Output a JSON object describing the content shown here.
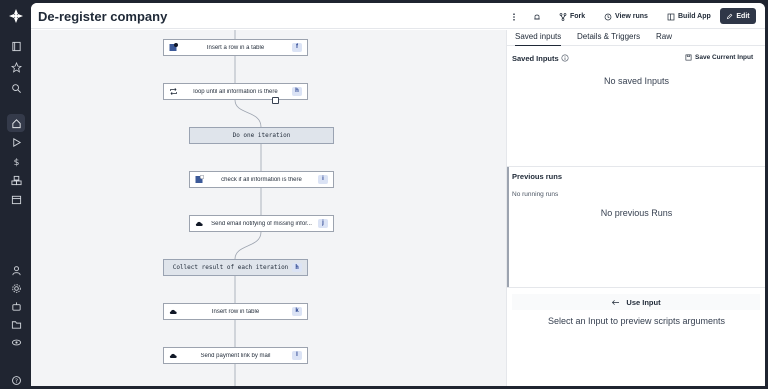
{
  "header": {
    "title": "De-register company",
    "fork_label": "Fork",
    "view_runs_label": "View runs",
    "build_app_label": "Build App",
    "edit_label": "Edit"
  },
  "flow": {
    "nodes": [
      {
        "label": "Insert a row in a table",
        "badge": "f",
        "icon": "table-icon"
      },
      {
        "label": "loop until all information is there",
        "badge": "h",
        "icon": "loop-icon"
      },
      {
        "label": "Do one iteration",
        "badge": "",
        "icon": ""
      },
      {
        "label": "check if all information is there",
        "badge": "i",
        "icon": "table-icon"
      },
      {
        "label": "Send email notifying of missing infor...",
        "badge": "j",
        "icon": "cloud-icon"
      },
      {
        "label": "Collect result of each iteration",
        "badge": "h",
        "icon": ""
      },
      {
        "label": "Insert row in table",
        "badge": "k",
        "icon": "cloud-icon"
      },
      {
        "label": "Send payment link by mail",
        "badge": "l",
        "icon": "cloud-icon"
      }
    ]
  },
  "right_panel": {
    "tabs": [
      "Saved inputs",
      "Details & Triggers",
      "Raw"
    ],
    "saved_inputs_title": "Saved Inputs",
    "save_current_label": "Save Current Input",
    "no_saved_inputs": "No saved Inputs",
    "previous_runs_title": "Previous runs",
    "no_running_runs": "No running runs",
    "no_previous_runs": "No previous Runs",
    "use_input_label": "Use Input",
    "preview_hint": "Select an Input to preview scripts arguments"
  },
  "colors": {
    "sidebar_bg": "#202531",
    "edit_button_bg": "#2f3748",
    "badge_bg": "#dbe3f5",
    "group_bg": "#dfe4eb"
  }
}
